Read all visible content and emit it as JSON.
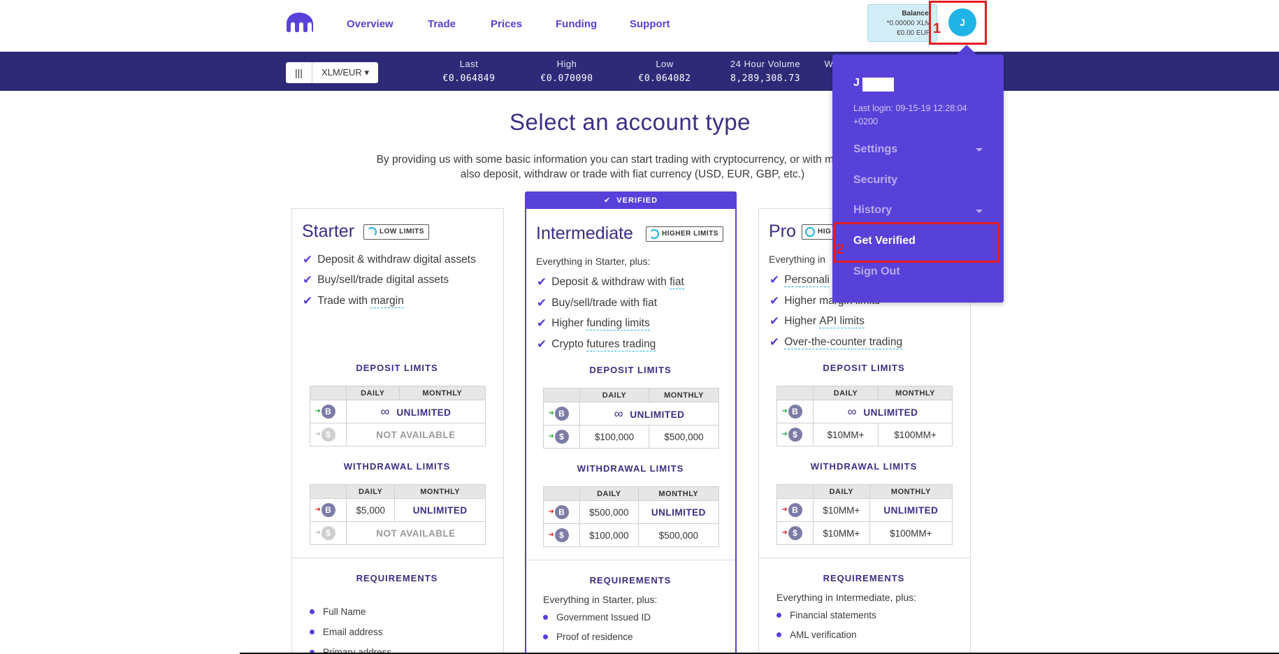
{
  "nav": {
    "overview": "Overview",
    "trade": "Trade",
    "prices": "Prices",
    "funding": "Funding",
    "support": "Support"
  },
  "balance": {
    "label": "Balance:",
    "xlm": "*0.00000 XLM",
    "eur": "€0.00 EUR"
  },
  "avatar": {
    "initial": "J"
  },
  "markers": {
    "one": "1",
    "two": "2"
  },
  "ticker": {
    "pair": "XLM/EUR",
    "last_label": "Last",
    "last_value": "€0.064849",
    "high_label": "High",
    "high_value": "€0.070090",
    "low_label": "Low",
    "low_value": "€0.064082",
    "volume_label": "24 Hour Volume",
    "volume_value": "8,289,308.73",
    "extra_label": "W"
  },
  "page": {
    "title": "Select an account type",
    "subtitle_line1": "By providing us with some basic information you can start trading with cryptocurrency, or with more informa",
    "subtitle_line2": "also deposit, withdraw or trade with fiat currency (USD, EUR, GBP, etc.)"
  },
  "starter": {
    "title": "Starter",
    "badge": "LOW LIMITS",
    "features": [
      "Deposit & withdraw digital assets",
      "Buy/sell/trade digital assets"
    ],
    "feature3_prefix": "Trade with ",
    "feature3_link": "margin",
    "deposit_heading": "DEPOSIT LIMITS",
    "withdraw_heading": "WITHDRAWAL LIMITS",
    "col_daily": "DAILY",
    "col_monthly": "MONTHLY",
    "dep_crypto": "UNLIMITED",
    "dep_fiat": "NOT AVAILABLE",
    "wd_crypto_daily": "$5,000",
    "wd_crypto_monthly": "UNLIMITED",
    "wd_fiat": "NOT AVAILABLE",
    "req_heading": "REQUIREMENTS",
    "requirements": [
      "Full Name",
      "Email address",
      "Primary address"
    ]
  },
  "intermediate": {
    "verified_tab": "VERIFIED",
    "title": "Intermediate",
    "badge": "HIGHER LIMITS",
    "intro": "Everything in Starter, plus:",
    "f1_prefix": "Deposit & withdraw with ",
    "f1_link": "fiat",
    "f2": "Buy/sell/trade with fiat",
    "f3_prefix": "Higher ",
    "f3_link": "funding limits",
    "f4_prefix": "Crypto ",
    "f4_link": "futures trading",
    "deposit_heading": "DEPOSIT LIMITS",
    "withdraw_heading": "WITHDRAWAL LIMITS",
    "col_daily": "DAILY",
    "col_monthly": "MONTHLY",
    "dep_crypto": "UNLIMITED",
    "dep_fiat_daily": "$100,000",
    "dep_fiat_monthly": "$500,000",
    "wd_crypto_daily": "$500,000",
    "wd_crypto_monthly": "UNLIMITED",
    "wd_fiat_daily": "$100,000",
    "wd_fiat_monthly": "$500,000",
    "req_heading": "REQUIREMENTS",
    "req_intro": "Everything in Starter, plus:",
    "requirements": [
      "Government Issued ID",
      "Proof of residence"
    ]
  },
  "pro": {
    "title": "Pro",
    "badge": "HIG",
    "intro": "Everything in",
    "f1_link": "Personali",
    "f2": "Higher margin limits",
    "f3_prefix": "Higher ",
    "f3_link": "API limits",
    "f4_link": "Over-the-counter trading",
    "deposit_heading": "DEPOSIT LIMITS",
    "withdraw_heading": "WITHDRAWAL LIMITS",
    "col_daily": "DAILY",
    "col_monthly": "MONTHLY",
    "dep_crypto": "UNLIMITED",
    "dep_fiat_daily": "$10MM+",
    "dep_fiat_monthly": "$100MM+",
    "wd_crypto_daily": "$10MM+",
    "wd_crypto_monthly": "UNLIMITED",
    "wd_fiat_daily": "$10MM+",
    "wd_fiat_monthly": "$100MM+",
    "req_heading": "REQUIREMENTS",
    "req_intro": "Everything in Intermediate, plus:",
    "requirements": [
      "Financial statements",
      "AML verification"
    ]
  },
  "dropdown": {
    "user": "J",
    "last_login": "Last login: 09-15-19 12:28:04 +0200",
    "settings": "Settings",
    "security": "Security",
    "history": "History",
    "get_verified": "Get Verified",
    "sign_out": "Sign Out"
  },
  "icons": {
    "crypto": "B",
    "fiat": "$",
    "infinity": "∞",
    "check": "✔",
    "chart": "|||"
  },
  "colors": {
    "brand": "#5741d9",
    "navy": "#2f2a78",
    "accent": "#1fb3e6",
    "highlight": "#e31b23"
  }
}
